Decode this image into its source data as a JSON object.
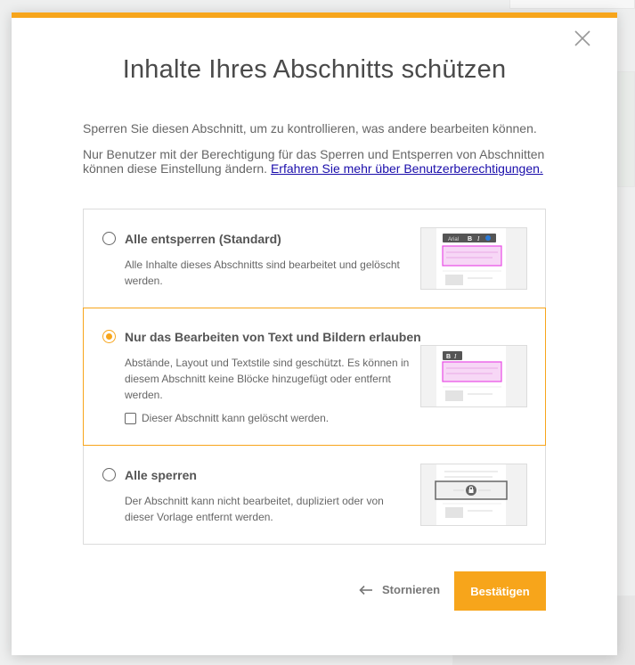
{
  "dialog": {
    "title": "Inhalte Ihres Abschnitts schützen",
    "intro_1": "Sperren Sie diesen Abschnitt, um zu kontrollieren, was andere bearbeiten können.",
    "intro_2": "Nur Benutzer mit der Berechtigung für das Sperren und Entsperren von Abschnitten können diese Einstellung ändern.",
    "intro_link": "Erfahren Sie mehr über Benutzerberechtigungen.",
    "close_icon": "close-icon"
  },
  "options": [
    {
      "title": "Alle entsperren (Standard)",
      "description": "Alle Inhalte dieses Abschnitts sind bearbeitet und gelöscht werden.",
      "selected": false
    },
    {
      "title": "Nur das Bearbeiten von Text und Bildern erlauben",
      "description": "Abstände, Layout und Textstile sind geschützt. Es können in diesem Abschnitt keine Blöcke hinzugefügt oder entfernt werden.",
      "checkbox_label": "Dieser Abschnitt kann gelöscht werden.",
      "checkbox_checked": false,
      "selected": true
    },
    {
      "title": "Alle sperren",
      "description": "Der Abschnitt kann nicht bearbeitet, dupliziert oder von dieser Vorlage entfernt werden.",
      "selected": false
    }
  ],
  "thumb_toolbar": {
    "font": "Arial",
    "bold": "B",
    "italic": "I"
  },
  "footer": {
    "cancel_label": "Stornieren",
    "confirm_label": "Bestätigen"
  },
  "colors": {
    "accent": "#f7a51b",
    "highlight": "#e94be6",
    "link": "#1a0dab"
  }
}
